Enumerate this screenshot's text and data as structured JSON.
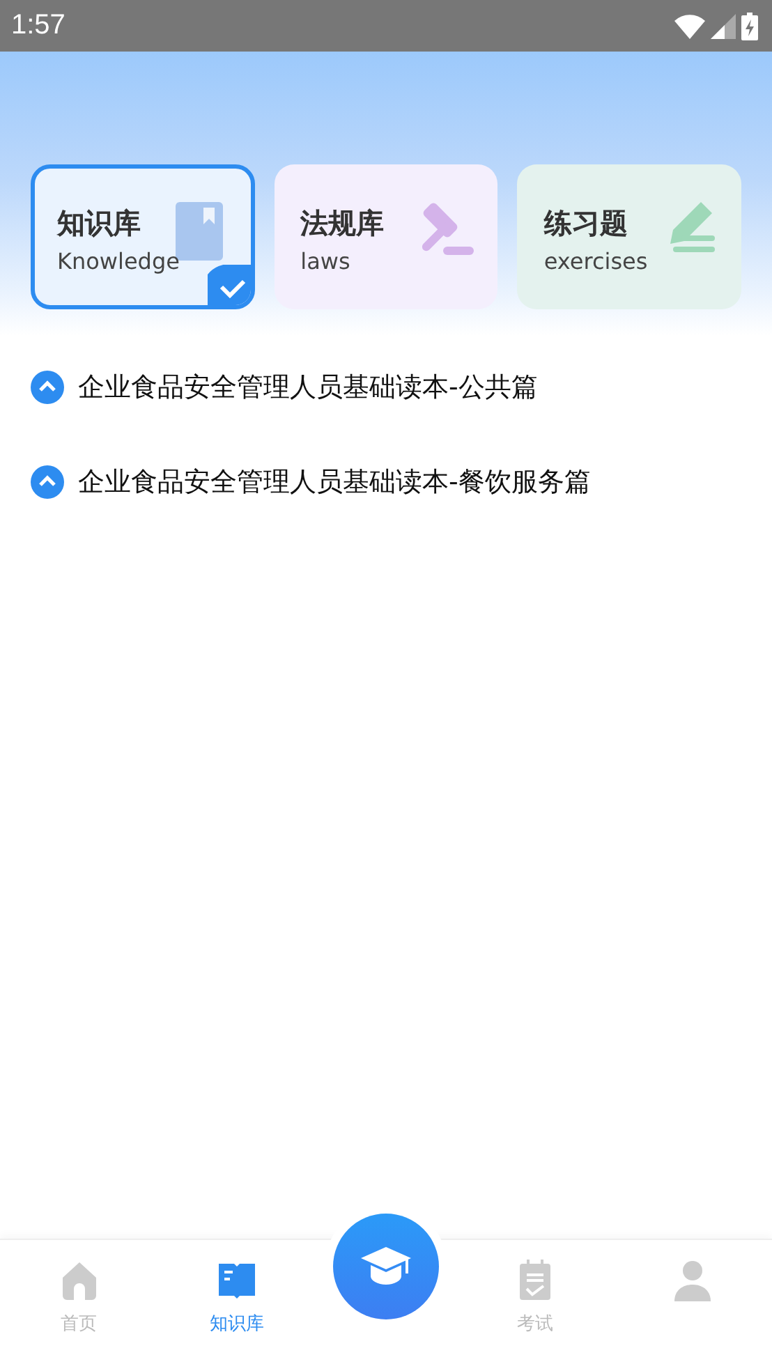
{
  "status_bar": {
    "time": "1:57"
  },
  "categories": [
    {
      "kind": "book",
      "title": "知识库",
      "subtitle": "Knowledge",
      "selected": true,
      "color": "#a9c6ef"
    },
    {
      "kind": "gavel",
      "title": "法规库",
      "subtitle": "laws",
      "selected": false,
      "color": "#d4b3ea"
    },
    {
      "kind": "pencil",
      "title": "练习题",
      "subtitle": "exercises",
      "selected": false,
      "color": "#9ed8b8"
    }
  ],
  "books": [
    {
      "title": "企业食品安全管理人员基础读本-公共篇"
    },
    {
      "title": "企业食品安全管理人员基础读本-餐饮服务篇"
    }
  ],
  "bottom_nav": [
    {
      "kind": "home",
      "label": "首页",
      "selected": false
    },
    {
      "kind": "book",
      "label": "知识库",
      "selected": true
    },
    {
      "kind": "cap"
    },
    {
      "kind": "exam",
      "label": "考试",
      "selected": false
    },
    {
      "kind": "person",
      "selected": false
    }
  ]
}
